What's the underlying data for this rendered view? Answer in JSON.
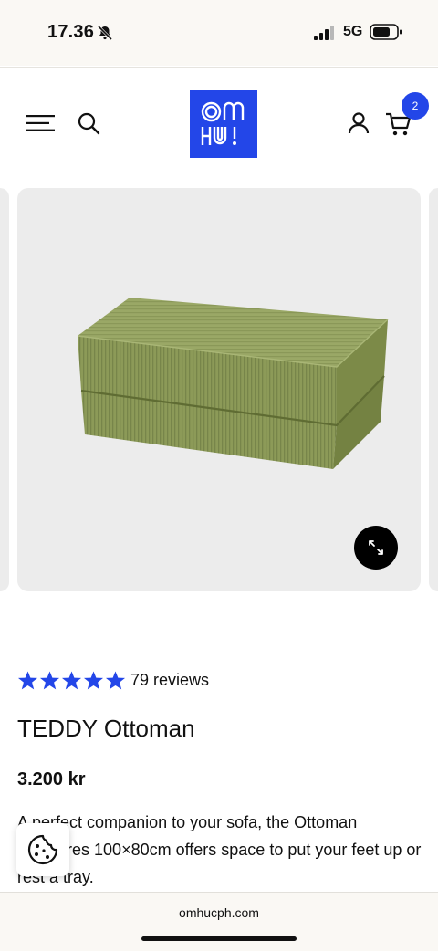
{
  "status_bar": {
    "time": "17.36",
    "network": "5G",
    "icons": [
      "bell-slash-icon",
      "signal-icon",
      "battery-icon"
    ]
  },
  "header": {
    "logo_text": "OM HU!",
    "cart_count": "2",
    "icons": [
      "menu-icon",
      "search-icon",
      "account-icon",
      "cart-icon"
    ],
    "brand_color": "#2346e8"
  },
  "gallery": {
    "image_alt": "Green corduroy ottoman",
    "zoom_icon": "expand-icon"
  },
  "product": {
    "rating": 5,
    "reviews_label": "79 reviews",
    "title": "TEDDY Ottoman",
    "price": "3.200 kr",
    "description": "A perfect companion to your sofa, the Ottoman measures 100×80cm offers space to put your feet up or rest a tray.",
    "star_color": "#2346e8"
  },
  "cookie": {
    "icon": "cookie-icon"
  },
  "browser": {
    "url": "omhucph.com"
  }
}
